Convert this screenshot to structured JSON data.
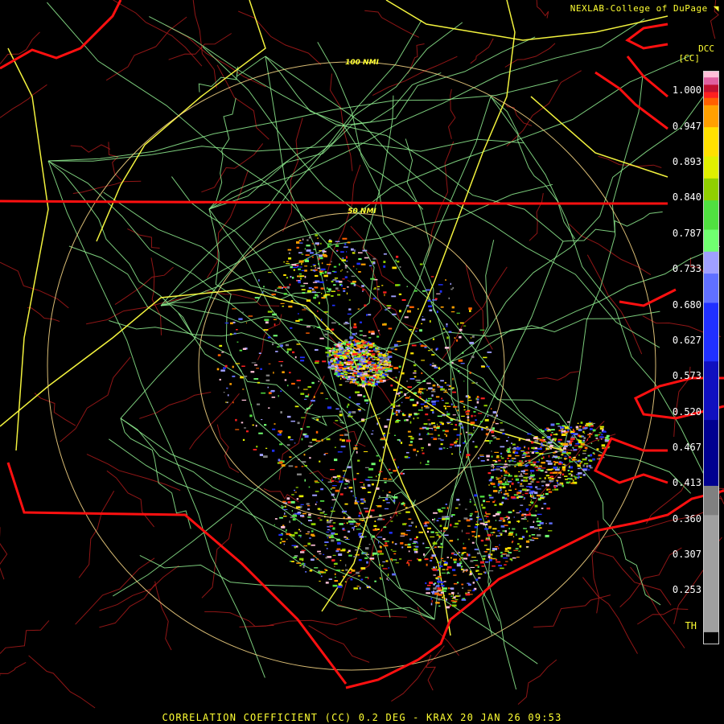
{
  "header": {
    "credit": "NEXLAB-College of DuPage"
  },
  "footer": {
    "caption": "CORRELATION COEFFICIENT (CC) 0.2 DEG - KRAX 20 JAN 26 09:53"
  },
  "colorbar": {
    "title_line1": "DCC",
    "title_line2": "[CC]",
    "ticks": [
      "1.000",
      "0.947",
      "0.893",
      "0.840",
      "0.787",
      "0.733",
      "0.680",
      "0.627",
      "0.573",
      "0.520",
      "0.467",
      "0.413",
      "0.360",
      "0.307",
      "0.253",
      "TH"
    ],
    "colors": [
      "#ffc0d8",
      "#e060a0",
      "#c01030",
      "#ff2020",
      "#ff6000",
      "#ffa000",
      "#ffe000",
      "#e0f000",
      "#90d000",
      "#50e040",
      "#70ff70",
      "#a0a0ff",
      "#6070ff",
      "#2030ff",
      "#1010c0",
      "#000090",
      "#808080",
      "#a0a0a0",
      "#000000"
    ]
  },
  "rings": {
    "inner_label": "50 NMI",
    "outer_label": "100 NMI"
  },
  "colors": {
    "state_border": "#ff1010",
    "county_line": "#a01818",
    "interstate": "#ffff40",
    "highway": "#90ee90",
    "ring": "#ffdd88",
    "text": "#ffff33"
  }
}
